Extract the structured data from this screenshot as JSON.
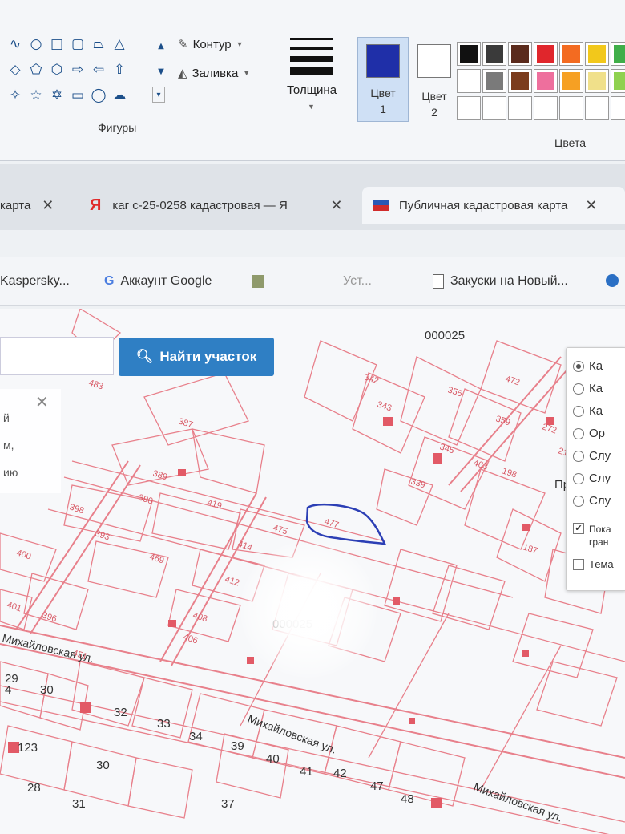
{
  "ribbon": {
    "shapes_label": "Фигуры",
    "shape_glyphs": [
      "∿",
      "○",
      "□",
      "▢",
      "⏢",
      "△",
      "◇",
      "⬠",
      "⬡",
      "⇨",
      "⇦",
      "⇧",
      "✧",
      "☆",
      "✡",
      "▭",
      "◯",
      "☁"
    ],
    "outline_label": "Контур",
    "fill_label": "Заливка",
    "thickness_label": "Толщина",
    "color1_label_line1": "Цвет",
    "color1_label_line2": "1",
    "color2_label_line1": "Цвет",
    "color2_label_line2": "2",
    "colors_label": "Цвета",
    "color1": "#1f2fa8",
    "color2": "#ffffff",
    "palette_row1": [
      "#111111",
      "#3a3a3a",
      "#5a2a1c",
      "#e0262c",
      "#f36b21",
      "#f2c81b",
      "#3fae49"
    ],
    "palette_row2": [
      "#ffffff",
      "#7a7a7a",
      "#7b3b1c",
      "#ee6f9d",
      "#f6a023",
      "#f0e08a",
      "#8fd14f"
    ]
  },
  "tabs": [
    {
      "title": "карта",
      "close": "✕"
    },
    {
      "icon": "Я",
      "title": "каг с-25-0258 кадастровая — Я",
      "close": "✕"
    },
    {
      "title": "Публичная кадастровая карта",
      "close": "✕"
    }
  ],
  "bookmarks": [
    {
      "label": "Kaspersky..."
    },
    {
      "icon": "G",
      "label": "Аккаунт Google"
    },
    {
      "label": "Уст..."
    },
    {
      "label": "Закуски на Новый..."
    }
  ],
  "map": {
    "find_button": "Найти участок",
    "left_panel": {
      "close": "✕",
      "line1": "й",
      "line2": "м,",
      "line3": "ию"
    },
    "layers": [
      {
        "label": "Ка",
        "selected": true
      },
      {
        "label": "Ка",
        "selected": false
      },
      {
        "label": "Ка",
        "selected": false
      },
      {
        "label": "Ор",
        "selected": false
      },
      {
        "label": "Слу",
        "selected": false
      },
      {
        "label": "Слу",
        "selected": false
      },
      {
        "label": "Слу",
        "selected": false
      }
    ],
    "check_show_line1": "Пока",
    "check_show_line2": "гран",
    "check_theme": "Тема",
    "quarter_top": "000025",
    "quarter_mid": "000025",
    "street1": "Михайловская ул.",
    "street2": "Михайловская ул.",
    "street3": "Михайловская ул.",
    "side_label": "Пр",
    "plot_numbers": [
      "483",
      "387",
      "389",
      "390",
      "419",
      "398",
      "393",
      "400",
      "469",
      "401",
      "396",
      "451",
      "475",
      "414",
      "412",
      "477",
      "408",
      "406",
      "342",
      "343",
      "356",
      "345",
      "463",
      "339",
      "472",
      "359",
      "198",
      "272",
      "211",
      "187"
    ],
    "house_numbers": [
      "29",
      "30",
      "32",
      "33",
      "34",
      "30",
      "39",
      "40",
      "41",
      "42",
      "28",
      "31",
      "37",
      "47",
      "48",
      "4",
      "123"
    ]
  }
}
